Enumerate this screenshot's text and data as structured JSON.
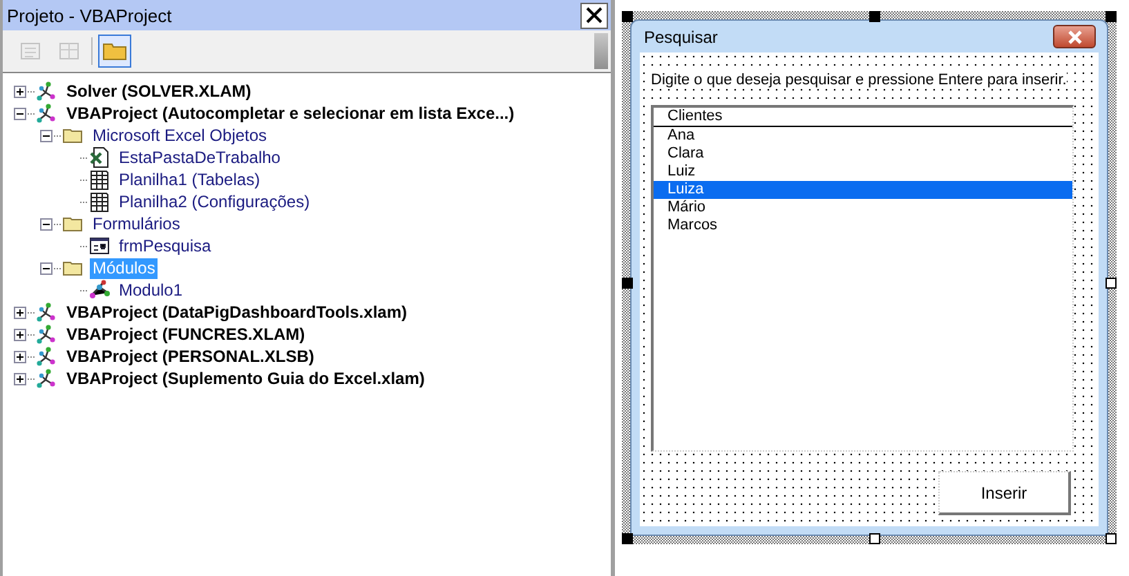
{
  "project_panel": {
    "title": "Projeto - VBAProject",
    "toolbar": [
      {
        "kind": "view-code",
        "disabled": true,
        "selected": false
      },
      {
        "kind": "view-object",
        "disabled": true,
        "selected": false
      },
      {
        "kind": "toggle-folders",
        "disabled": false,
        "selected": true
      }
    ],
    "tree": [
      {
        "label": "Solver (SOLVER.XLAM)",
        "kind": "project",
        "expanded": false,
        "selected": false
      },
      {
        "label": "VBAProject (Autocompletar e selecionar em lista Exce...)",
        "kind": "project",
        "expanded": true,
        "selected": false,
        "children": [
          {
            "label": "Microsoft Excel Objetos",
            "kind": "folder",
            "expanded": true,
            "selected": false,
            "children": [
              {
                "label": "EstaPastaDeTrabalho",
                "kind": "workbook",
                "selected": false
              },
              {
                "label": "Planilha1 (Tabelas)",
                "kind": "sheet",
                "selected": false
              },
              {
                "label": "Planilha2 (Configurações)",
                "kind": "sheet",
                "selected": false
              }
            ]
          },
          {
            "label": "Formulários",
            "kind": "folder",
            "expanded": true,
            "selected": false,
            "children": [
              {
                "label": "frmPesquisa",
                "kind": "form",
                "selected": false
              }
            ]
          },
          {
            "label": "Módulos",
            "kind": "folder",
            "expanded": true,
            "selected": true,
            "children": [
              {
                "label": "Modulo1",
                "kind": "module",
                "selected": false
              }
            ]
          }
        ]
      },
      {
        "label": "VBAProject (DataPigDashboardTools.xlam)",
        "kind": "project",
        "expanded": false,
        "selected": false
      },
      {
        "label": "VBAProject (FUNCRES.XLAM)",
        "kind": "project",
        "expanded": false,
        "selected": false
      },
      {
        "label": "VBAProject (PERSONAL.XLSB)",
        "kind": "project",
        "expanded": false,
        "selected": false
      },
      {
        "label": "VBAProject (Suplemento Guia do Excel.xlam)",
        "kind": "project",
        "expanded": false,
        "selected": false
      }
    ]
  },
  "form_designer": {
    "title": "Pesquisar",
    "instruction": "Digite o que deseja pesquisar e pressione Entere para inserir.",
    "list": {
      "header": "Clientes",
      "items": [
        {
          "label": "Ana",
          "selected": false
        },
        {
          "label": "Clara",
          "selected": false
        },
        {
          "label": "Luiz",
          "selected": false
        },
        {
          "label": "Luiza",
          "selected": true
        },
        {
          "label": "Mário",
          "selected": false
        },
        {
          "label": "Marcos",
          "selected": false
        }
      ]
    },
    "button": "Inserir"
  }
}
